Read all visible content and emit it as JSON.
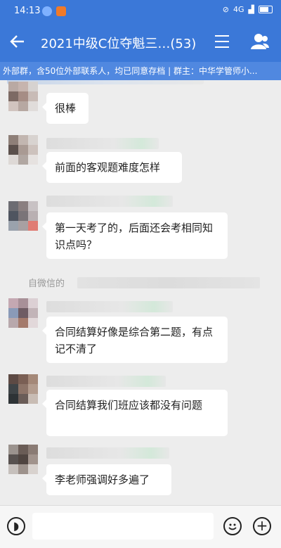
{
  "status_bar": {
    "time": "14:13",
    "signal_label": "4G",
    "icons": [
      "navigation-app-icon",
      "orange-app-icon",
      "hd-icon",
      "wifi-icon",
      "signal-icon",
      "battery-icon"
    ]
  },
  "header": {
    "title": "2021中级C位夺魁三…(53)",
    "back_icon": "arrow-left-icon",
    "menu_icon": "hamburger-icon",
    "members_icon": "user-icon",
    "accent_color": "#3b78d8"
  },
  "banner": {
    "text": "外部群，含50位外部联系人，均已同意存档 | 群主：中华学管师小..."
  },
  "messages": [
    {
      "text": "很棒"
    },
    {
      "text": "前面的客观题难度怎样"
    },
    {
      "text": "第一天考了的，后面还会考相同知识点吗？"
    },
    {
      "text": "合同结算好像是综合第二题，有点记不清了"
    },
    {
      "text": "合同结算我们班应该都没有问题"
    },
    {
      "text": "李老师强调好多遍了"
    }
  ],
  "system_note": {
    "text": "自微信的"
  },
  "input_bar": {
    "voice_icon": "voice-icon",
    "emoji_icon": "emoji-icon",
    "plus_icon": "plus-icon"
  }
}
